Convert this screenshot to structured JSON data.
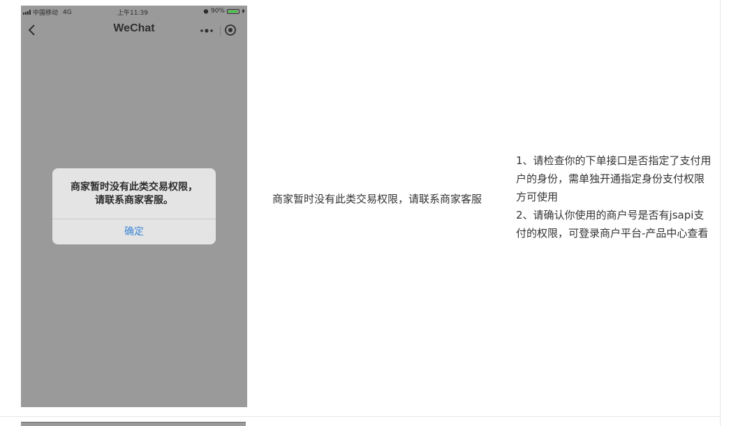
{
  "status_bar": {
    "carrier": "中国移动",
    "network": "4G",
    "time": "上午11:39",
    "battery_percent": "90%",
    "battery_level": 0.9
  },
  "nav": {
    "title": "WeChat"
  },
  "alert": {
    "message": "商家暂时没有此类交易权限，\n请联系商家客服。",
    "confirm_label": "确定"
  },
  "table": {
    "description": "商家暂时没有此类交易权限，请联系商家客服",
    "solution_lines": [
      "1、请检查你的下单接口是否指定了支付用户的身份，需单独开通指定身份支付权限方可使用",
      "2、请确认你使用的商户号是否有jsapi支付的权限，可登录商户平台-产品中心查看"
    ]
  },
  "colors": {
    "overlay": "#9a9a9a",
    "alert_bg": "#e4e4e4",
    "link_blue": "#3b86d8",
    "battery_green": "#3ec43e"
  }
}
